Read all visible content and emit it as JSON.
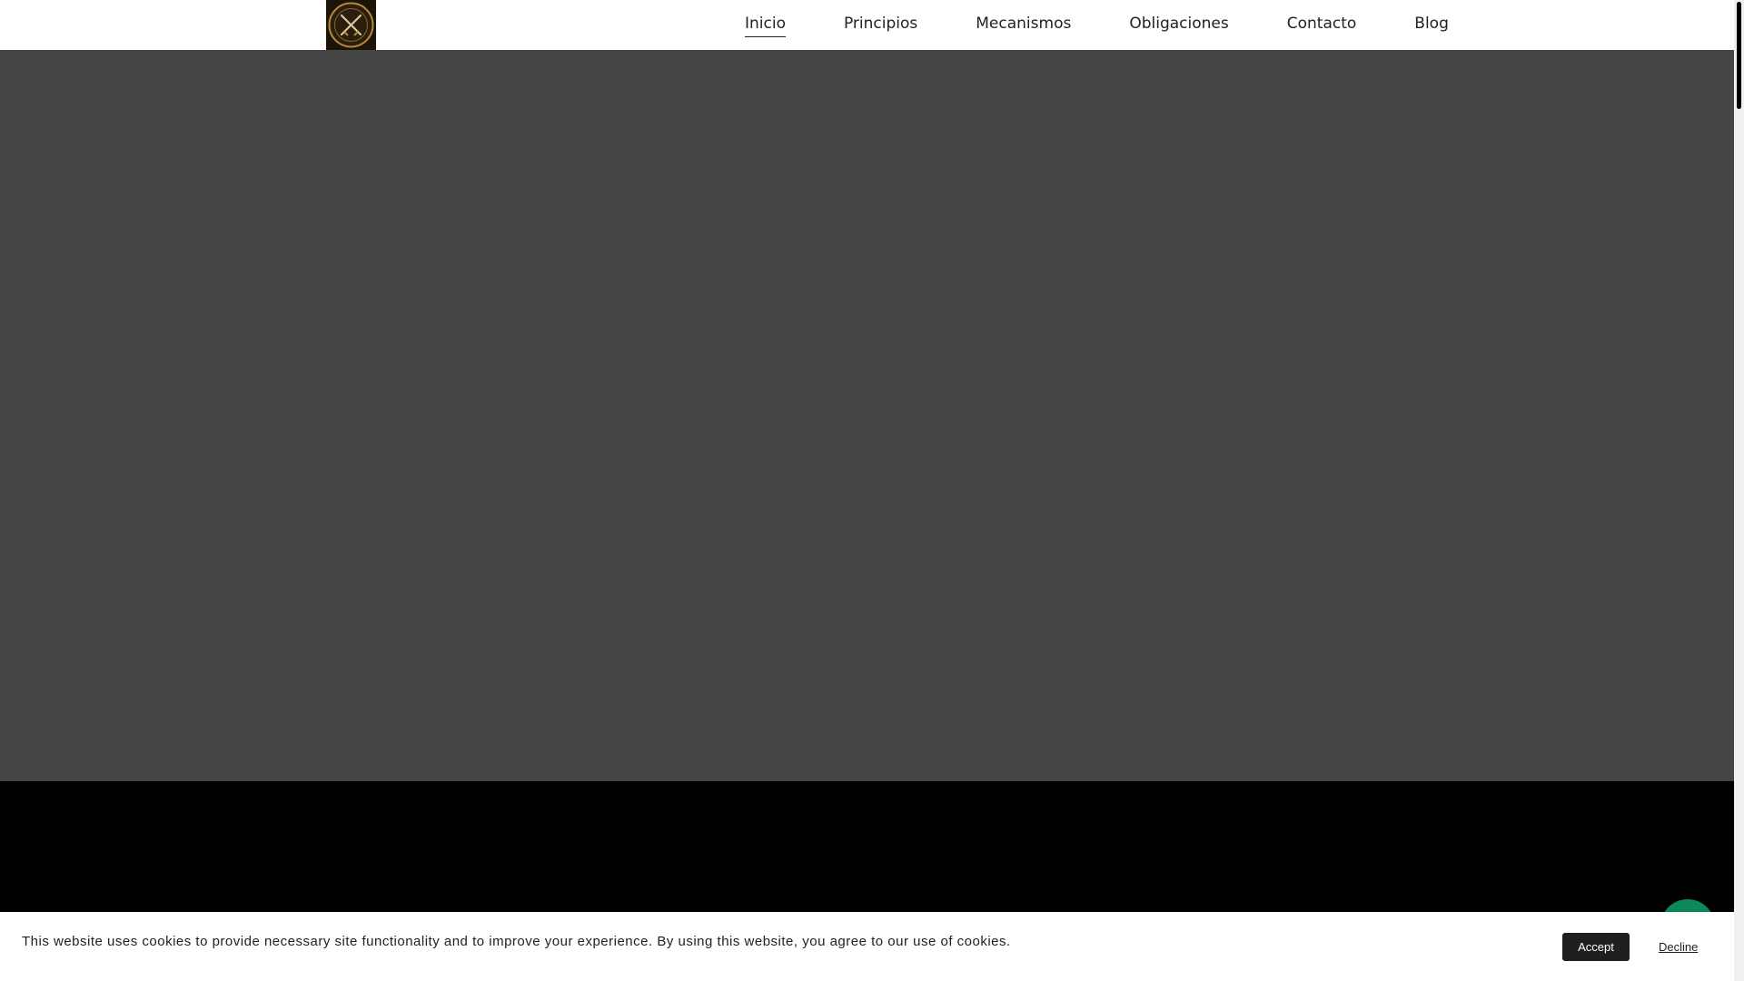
{
  "header": {
    "logo_icon": "crossed-swords-emblem",
    "nav": [
      {
        "label": "Inicio",
        "active": true
      },
      {
        "label": "Principios",
        "active": false
      },
      {
        "label": "Mecanismos",
        "active": false
      },
      {
        "label": "Obligaciones",
        "active": false
      },
      {
        "label": "Contacto",
        "active": false
      },
      {
        "label": "Blog",
        "active": false
      }
    ]
  },
  "colors": {
    "hero_bg": "#454545",
    "dark_section_bg": "#000000",
    "chat_button": "#0d8a5b",
    "accept_button": "#1f1f1f"
  },
  "chat": {
    "icon": "chat-bubble-icon"
  },
  "cookie": {
    "text": "This website uses cookies to provide necessary site functionality and to improve your experience. By using this website, you agree to our use of cookies.",
    "accept_label": "Accept",
    "decline_label": "Decline"
  }
}
